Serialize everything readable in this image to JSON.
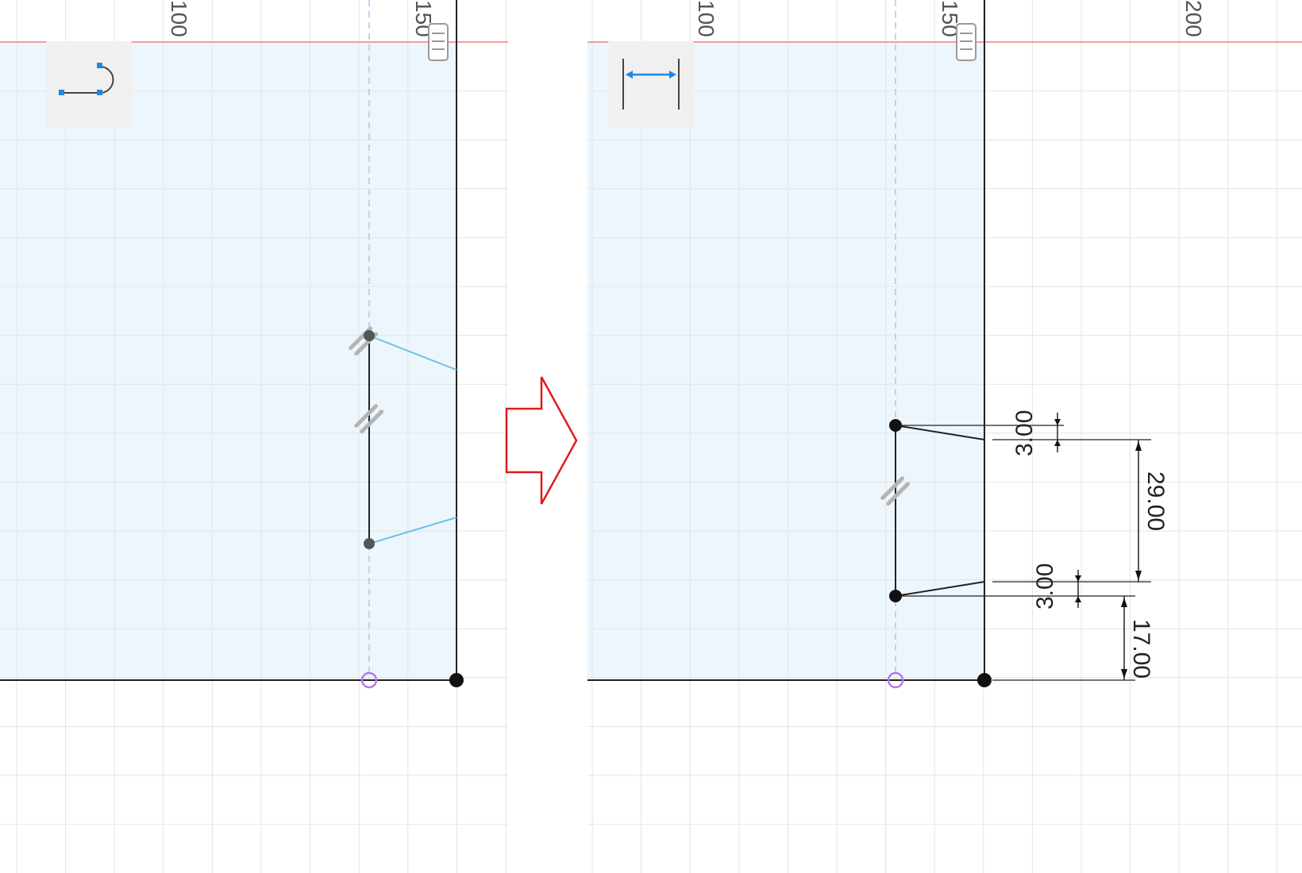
{
  "left_view": {
    "ruler_labels": [
      "100",
      "150"
    ],
    "tool_icon": "tangent-arc-icon"
  },
  "right_view": {
    "ruler_labels": [
      "100",
      "150",
      "200"
    ],
    "tool_icon": "sketch-dimension-icon",
    "dimensions": {
      "top_offset": "3.00",
      "span": "29.00",
      "bottom_offset": "3.00",
      "base_offset": "17.00"
    }
  },
  "transition_icon": "right-arrow-icon",
  "colors": {
    "sketch_fill": "#edf6fc",
    "grid": "#e4e4e4",
    "axis_red": "#f08080",
    "projection_line": "#6ec0e6",
    "construction_line": "#c4b8ee",
    "origin_marker": "#b47ae6",
    "tool_accent": "#1e88e5",
    "arrow_red": "#e01b1b"
  }
}
